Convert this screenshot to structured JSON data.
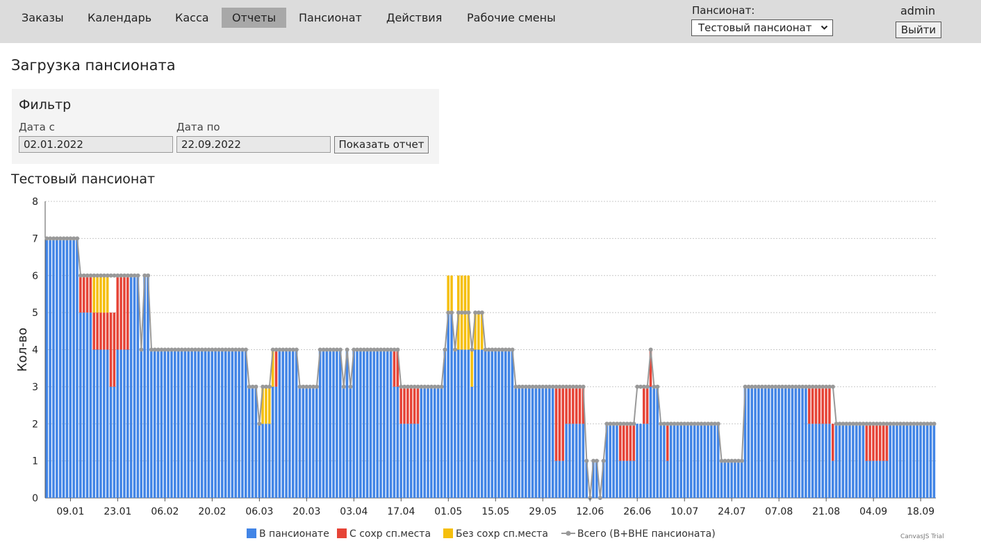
{
  "nav": {
    "items": [
      {
        "label": "Заказы",
        "name": "nav-orders",
        "active": false
      },
      {
        "label": "Календарь",
        "name": "nav-calendar",
        "active": false
      },
      {
        "label": "Касса",
        "name": "nav-cash",
        "active": false
      },
      {
        "label": "Отчеты",
        "name": "nav-reports",
        "active": true
      },
      {
        "label": "Пансионат",
        "name": "nav-pension",
        "active": false
      },
      {
        "label": "Действия",
        "name": "nav-actions",
        "active": false
      },
      {
        "label": "Рабочие смены",
        "name": "nav-shifts",
        "active": false
      }
    ]
  },
  "header": {
    "pension_label": "Пансионат:",
    "pension_selected": "Тестовый пансионат",
    "user": "admin",
    "logout_label": "Выйти"
  },
  "page": {
    "title": "Загрузка пансионата"
  },
  "filter": {
    "title": "Фильтр",
    "from_label": "Дата с",
    "from_value": "02.01.2022",
    "to_label": "Дата по",
    "to_value": "22.09.2022",
    "submit_label": "Показать отчет"
  },
  "chart_title": "Тестовый пансионат",
  "watermark": "CanvasJS Trial",
  "colors": {
    "in": "#4285e6",
    "kept": "#e64437",
    "notkept": "#f5bf0d",
    "total": "#999999"
  },
  "chart_data": {
    "type": "bar",
    "stacked": true,
    "title": "Тестовый пансионат",
    "xlabel": "",
    "ylabel": "Кол-во",
    "ylim": [
      0,
      8
    ],
    "yticks": [
      0,
      1,
      2,
      3,
      4,
      5,
      6,
      7,
      8
    ],
    "grid": true,
    "legend_position": "bottom",
    "x_range": [
      "02.01.2022",
      "22.09.2022"
    ],
    "xticks": [
      "09.01",
      "23.01",
      "06.02",
      "20.02",
      "06.03",
      "20.03",
      "03.04",
      "17.04",
      "01.05",
      "15.05",
      "29.05",
      "12.06",
      "26.06",
      "10.07",
      "24.07",
      "07.08",
      "21.08",
      "04.09",
      "18.09"
    ],
    "series": [
      {
        "name": "В пансионате",
        "type": "stackedColumn",
        "segments": [
          {
            "from": "02.01",
            "to": "11.01",
            "value": 7
          },
          {
            "from": "12.01",
            "to": "15.01",
            "value": 5
          },
          {
            "from": "16.01",
            "to": "20.01",
            "value": 4
          },
          {
            "from": "21.01",
            "to": "22.01",
            "value": 3
          },
          {
            "from": "23.01",
            "to": "26.01",
            "value": 4
          },
          {
            "from": "27.01",
            "to": "29.01",
            "value": 6
          },
          {
            "from": "30.01",
            "to": "30.01",
            "value": 4
          },
          {
            "from": "31.01",
            "to": "01.02",
            "value": 6
          },
          {
            "from": "02.02",
            "to": "02.03",
            "value": 4
          },
          {
            "from": "03.03",
            "to": "05.03",
            "value": 3
          },
          {
            "from": "06.03",
            "to": "06.03",
            "value": 2
          },
          {
            "from": "07.03",
            "to": "09.03",
            "value": 2
          },
          {
            "from": "10.03",
            "to": "11.03",
            "value": 3
          },
          {
            "from": "12.03",
            "to": "17.03",
            "value": 4
          },
          {
            "from": "18.03",
            "to": "23.03",
            "value": 3
          },
          {
            "from": "24.03",
            "to": "30.03",
            "value": 4
          },
          {
            "from": "31.03",
            "to": "31.03",
            "value": 3
          },
          {
            "from": "01.04",
            "to": "01.04",
            "value": 4
          },
          {
            "from": "02.04",
            "to": "02.04",
            "value": 3
          },
          {
            "from": "03.04",
            "to": "14.04",
            "value": 4
          },
          {
            "from": "15.04",
            "to": "16.04",
            "value": 3
          },
          {
            "from": "17.04",
            "to": "22.04",
            "value": 2
          },
          {
            "from": "23.04",
            "to": "29.04",
            "value": 3
          },
          {
            "from": "30.04",
            "to": "30.04",
            "value": 4
          },
          {
            "from": "01.05",
            "to": "02.05",
            "value": 5
          },
          {
            "from": "03.05",
            "to": "07.05",
            "value": 4
          },
          {
            "from": "08.05",
            "to": "08.05",
            "value": 3
          },
          {
            "from": "09.05",
            "to": "20.05",
            "value": 4
          },
          {
            "from": "21.05",
            "to": "01.06",
            "value": 3
          },
          {
            "from": "02.06",
            "to": "04.06",
            "value": 1
          },
          {
            "from": "05.06",
            "to": "10.06",
            "value": 2
          },
          {
            "from": "11.06",
            "to": "11.06",
            "value": 1
          },
          {
            "from": "12.06",
            "to": "12.06",
            "value": 0
          },
          {
            "from": "13.06",
            "to": "14.06",
            "value": 1
          },
          {
            "from": "15.06",
            "to": "15.06",
            "value": 0
          },
          {
            "from": "16.06",
            "to": "16.06",
            "value": 1
          },
          {
            "from": "17.06",
            "to": "20.06",
            "value": 2
          },
          {
            "from": "21.06",
            "to": "25.06",
            "value": 1
          },
          {
            "from": "26.06",
            "to": "29.06",
            "value": 2
          },
          {
            "from": "30.06",
            "to": "30.06",
            "value": 3
          },
          {
            "from": "01.07",
            "to": "02.07",
            "value": 3
          },
          {
            "from": "03.07",
            "to": "04.07",
            "value": 2
          },
          {
            "from": "05.07",
            "to": "05.07",
            "value": 1
          },
          {
            "from": "06.07",
            "to": "20.07",
            "value": 2
          },
          {
            "from": "21.07",
            "to": "27.07",
            "value": 1
          },
          {
            "from": "28.07",
            "to": "15.08",
            "value": 3
          },
          {
            "from": "16.08",
            "to": "22.08",
            "value": 2
          },
          {
            "from": "23.08",
            "to": "23.08",
            "value": 1
          },
          {
            "from": "24.08",
            "to": "01.09",
            "value": 2
          },
          {
            "from": "02.09",
            "to": "08.09",
            "value": 1
          },
          {
            "from": "09.09",
            "to": "22.09",
            "value": 2
          }
        ]
      },
      {
        "name": "С сохр сп.места",
        "type": "stackedColumn",
        "segments": [
          {
            "from": "12.01",
            "to": "15.01",
            "value": 1
          },
          {
            "from": "16.01",
            "to": "20.01",
            "value": 1
          },
          {
            "from": "21.01",
            "to": "22.01",
            "value": 2
          },
          {
            "from": "23.01",
            "to": "26.01",
            "value": 2
          },
          {
            "from": "11.03",
            "to": "11.03",
            "value": 1
          },
          {
            "from": "15.04",
            "to": "16.04",
            "value": 1
          },
          {
            "from": "17.04",
            "to": "22.04",
            "value": 1
          },
          {
            "from": "02.06",
            "to": "04.06",
            "value": 2
          },
          {
            "from": "05.06",
            "to": "10.06",
            "value": 1
          },
          {
            "from": "21.06",
            "to": "25.06",
            "value": 1
          },
          {
            "from": "28.06",
            "to": "29.06",
            "value": 1
          },
          {
            "from": "30.06",
            "to": "30.06",
            "value": 1
          },
          {
            "from": "05.07",
            "to": "05.07",
            "value": 1
          },
          {
            "from": "16.08",
            "to": "22.08",
            "value": 1
          },
          {
            "from": "23.08",
            "to": "23.08",
            "value": 1
          },
          {
            "from": "02.09",
            "to": "08.09",
            "value": 1
          }
        ]
      },
      {
        "name": "Без сохр сп.места",
        "type": "stackedColumn",
        "segments": [
          {
            "from": "16.01",
            "to": "20.01",
            "value": 1
          },
          {
            "from": "07.03",
            "to": "09.03",
            "value": 1
          },
          {
            "from": "10.03",
            "to": "10.03",
            "value": 1
          },
          {
            "from": "01.05",
            "to": "02.05",
            "value": 1
          },
          {
            "from": "04.05",
            "to": "07.05",
            "value": 2
          },
          {
            "from": "08.05",
            "to": "08.05",
            "value": 1
          },
          {
            "from": "09.05",
            "to": "11.05",
            "value": 1
          }
        ]
      },
      {
        "name": "Всего (В+ВНЕ пансионата)",
        "type": "line",
        "segments": [
          {
            "from": "02.01",
            "to": "11.01",
            "value": 7
          },
          {
            "from": "12.01",
            "to": "29.01",
            "value": 6
          },
          {
            "from": "30.01",
            "to": "30.01",
            "value": 4
          },
          {
            "from": "31.01",
            "to": "01.02",
            "value": 6
          },
          {
            "from": "02.02",
            "to": "02.03",
            "value": 4
          },
          {
            "from": "03.03",
            "to": "05.03",
            "value": 3
          },
          {
            "from": "06.03",
            "to": "06.03",
            "value": 2
          },
          {
            "from": "07.03",
            "to": "09.03",
            "value": 3
          },
          {
            "from": "10.03",
            "to": "17.03",
            "value": 4
          },
          {
            "from": "18.03",
            "to": "23.03",
            "value": 3
          },
          {
            "from": "24.03",
            "to": "30.03",
            "value": 4
          },
          {
            "from": "31.03",
            "to": "31.03",
            "value": 3
          },
          {
            "from": "01.04",
            "to": "01.04",
            "value": 4
          },
          {
            "from": "02.04",
            "to": "02.04",
            "value": 3
          },
          {
            "from": "03.04",
            "to": "16.04",
            "value": 4
          },
          {
            "from": "17.04",
            "to": "29.04",
            "value": 3
          },
          {
            "from": "30.04",
            "to": "30.04",
            "value": 4
          },
          {
            "from": "01.05",
            "to": "02.05",
            "value": 5
          },
          {
            "from": "03.05",
            "to": "03.05",
            "value": 4
          },
          {
            "from": "04.05",
            "to": "07.05",
            "value": 5
          },
          {
            "from": "08.05",
            "to": "08.05",
            "value": 4
          },
          {
            "from": "09.05",
            "to": "11.05",
            "value": 5
          },
          {
            "from": "12.05",
            "to": "20.05",
            "value": 4
          },
          {
            "from": "21.05",
            "to": "10.06",
            "value": 3
          },
          {
            "from": "11.06",
            "to": "11.06",
            "value": 1
          },
          {
            "from": "12.06",
            "to": "12.06",
            "value": 0
          },
          {
            "from": "13.06",
            "to": "14.06",
            "value": 1
          },
          {
            "from": "15.06",
            "to": "15.06",
            "value": 0
          },
          {
            "from": "16.06",
            "to": "16.06",
            "value": 1
          },
          {
            "from": "17.06",
            "to": "25.06",
            "value": 2
          },
          {
            "from": "26.06",
            "to": "29.06",
            "value": 3
          },
          {
            "from": "30.06",
            "to": "30.06",
            "value": 4
          },
          {
            "from": "01.07",
            "to": "02.07",
            "value": 3
          },
          {
            "from": "03.07",
            "to": "20.07",
            "value": 2
          },
          {
            "from": "21.07",
            "to": "27.07",
            "value": 1
          },
          {
            "from": "28.07",
            "to": "23.08",
            "value": 3
          },
          {
            "from": "24.08",
            "to": "22.09",
            "value": 2
          }
        ]
      }
    ]
  }
}
